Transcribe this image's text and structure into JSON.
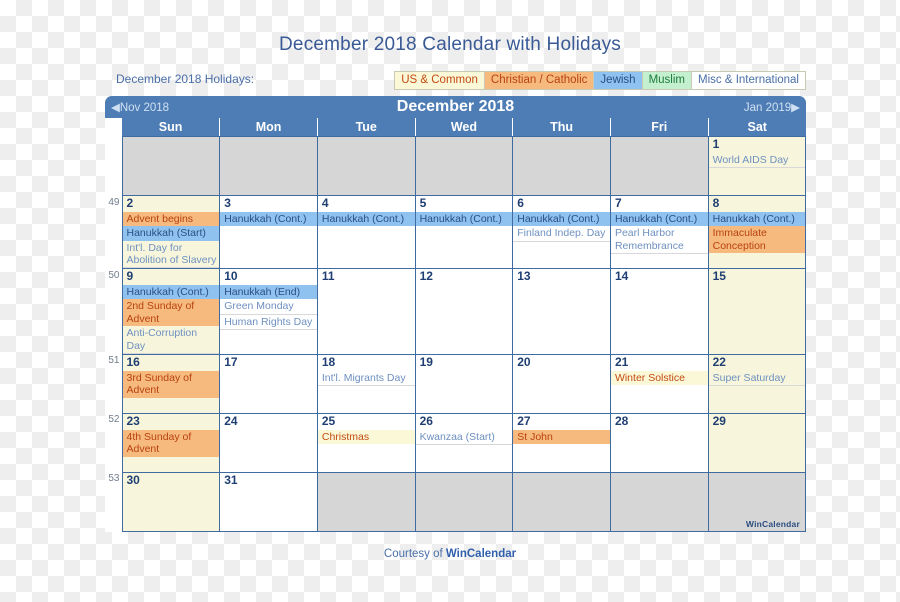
{
  "title": "December 2018 Calendar with Holidays",
  "legend": {
    "label": "December 2018 Holidays:",
    "chips": [
      {
        "key": "us",
        "label": "US & Common"
      },
      {
        "key": "chr",
        "label": "Christian / Catholic"
      },
      {
        "key": "jew",
        "label": "Jewish"
      },
      {
        "key": "mus",
        "label": "Muslim"
      },
      {
        "key": "misc",
        "label": "Misc & International"
      }
    ],
    "colors": {
      "us_bg": "#fbf8d7",
      "us_fg": "#c24a12",
      "chr_bg": "#f6b97e",
      "chr_fg": "#b8430e",
      "jew_bg": "#8fc2ef",
      "jew_fg": "#2a4f85",
      "mus_bg": "#c5f0cf",
      "mus_fg": "#1d7c3c",
      "misc_bg": "#ffffff",
      "misc_fg": "#4a6fa8"
    }
  },
  "calendar": {
    "header": {
      "prev": "◀Nov 2018",
      "month": "December 2018",
      "next": "Jan 2019▶",
      "bar_color": "#4e7db5"
    },
    "dow": [
      "Sun",
      "Mon",
      "Tue",
      "Wed",
      "Thu",
      "Fri",
      "Sat"
    ],
    "weeks": [
      {
        "wknum": "",
        "days": [
          {
            "num": "",
            "blank": true,
            "events": []
          },
          {
            "num": "",
            "blank": true,
            "events": []
          },
          {
            "num": "",
            "blank": true,
            "events": []
          },
          {
            "num": "",
            "blank": true,
            "events": []
          },
          {
            "num": "",
            "blank": true,
            "events": []
          },
          {
            "num": "",
            "blank": true,
            "events": []
          },
          {
            "num": "1",
            "blank": false,
            "weekend": true,
            "events": [
              {
                "text": "World AIDS Day",
                "cat": "misc"
              }
            ]
          }
        ]
      },
      {
        "wknum": "49",
        "days": [
          {
            "num": "2",
            "weekend": true,
            "events": [
              {
                "text": "Advent begins",
                "cat": "chr"
              },
              {
                "text": "Hanukkah (Start)",
                "cat": "jew"
              },
              {
                "text": "Int'l. Day for Abolition of Slavery",
                "cat": "misc"
              }
            ]
          },
          {
            "num": "3",
            "events": [
              {
                "text": "Hanukkah (Cont.)",
                "cat": "jew"
              }
            ]
          },
          {
            "num": "4",
            "events": [
              {
                "text": "Hanukkah (Cont.)",
                "cat": "jew"
              }
            ]
          },
          {
            "num": "5",
            "events": [
              {
                "text": "Hanukkah (Cont.)",
                "cat": "jew"
              }
            ]
          },
          {
            "num": "6",
            "events": [
              {
                "text": "Hanukkah (Cont.)",
                "cat": "jew"
              },
              {
                "text": "Finland Indep. Day",
                "cat": "misc"
              }
            ]
          },
          {
            "num": "7",
            "events": [
              {
                "text": "Hanukkah (Cont.)",
                "cat": "jew"
              },
              {
                "text": "Pearl Harbor Remembrance",
                "cat": "misc"
              }
            ]
          },
          {
            "num": "8",
            "weekend": true,
            "events": [
              {
                "text": "Hanukkah (Cont.)",
                "cat": "jew"
              },
              {
                "text": "Immaculate Conception",
                "cat": "chr"
              }
            ]
          }
        ]
      },
      {
        "wknum": "50",
        "days": [
          {
            "num": "9",
            "weekend": true,
            "events": [
              {
                "text": "Hanukkah (Cont.)",
                "cat": "jew"
              },
              {
                "text": "2nd Sunday of Advent",
                "cat": "chr"
              },
              {
                "text": "Anti-Corruption Day",
                "cat": "misc"
              }
            ]
          },
          {
            "num": "10",
            "events": [
              {
                "text": "Hanukkah (End)",
                "cat": "jew"
              },
              {
                "text": "Green Monday",
                "cat": "misc"
              },
              {
                "text": "Human Rights Day",
                "cat": "misc"
              }
            ]
          },
          {
            "num": "11",
            "events": []
          },
          {
            "num": "12",
            "events": []
          },
          {
            "num": "13",
            "events": []
          },
          {
            "num": "14",
            "events": []
          },
          {
            "num": "15",
            "weekend": true,
            "events": []
          }
        ]
      },
      {
        "wknum": "51",
        "days": [
          {
            "num": "16",
            "weekend": true,
            "events": [
              {
                "text": "3rd Sunday of Advent",
                "cat": "chr"
              }
            ]
          },
          {
            "num": "17",
            "events": []
          },
          {
            "num": "18",
            "events": [
              {
                "text": "Int'l. Migrants Day",
                "cat": "misc"
              }
            ]
          },
          {
            "num": "19",
            "events": []
          },
          {
            "num": "20",
            "events": []
          },
          {
            "num": "21",
            "events": [
              {
                "text": "Winter Solstice",
                "cat": "us"
              }
            ]
          },
          {
            "num": "22",
            "weekend": true,
            "events": [
              {
                "text": "Super Saturday",
                "cat": "misc"
              }
            ]
          }
        ]
      },
      {
        "wknum": "52",
        "days": [
          {
            "num": "23",
            "weekend": true,
            "events": [
              {
                "text": "4th Sunday of Advent",
                "cat": "chr"
              }
            ]
          },
          {
            "num": "24",
            "events": []
          },
          {
            "num": "25",
            "events": [
              {
                "text": "Christmas",
                "cat": "us"
              }
            ]
          },
          {
            "num": "26",
            "events": [
              {
                "text": "Kwanzaa (Start)",
                "cat": "misc"
              }
            ]
          },
          {
            "num": "27",
            "events": [
              {
                "text": "St John",
                "cat": "chr"
              }
            ]
          },
          {
            "num": "28",
            "events": []
          },
          {
            "num": "29",
            "weekend": true,
            "events": []
          }
        ]
      },
      {
        "wknum": "53",
        "days": [
          {
            "num": "30",
            "weekend": true,
            "events": []
          },
          {
            "num": "31",
            "events": []
          },
          {
            "num": "",
            "blank": true,
            "events": []
          },
          {
            "num": "",
            "blank": true,
            "events": []
          },
          {
            "num": "",
            "blank": true,
            "events": []
          },
          {
            "num": "",
            "blank": true,
            "events": []
          },
          {
            "num": "",
            "blank": true,
            "events": []
          }
        ]
      }
    ],
    "watermark": "WinCalendar"
  },
  "footer": {
    "prefix": "Courtesy of ",
    "brand": "WinCalendar"
  }
}
